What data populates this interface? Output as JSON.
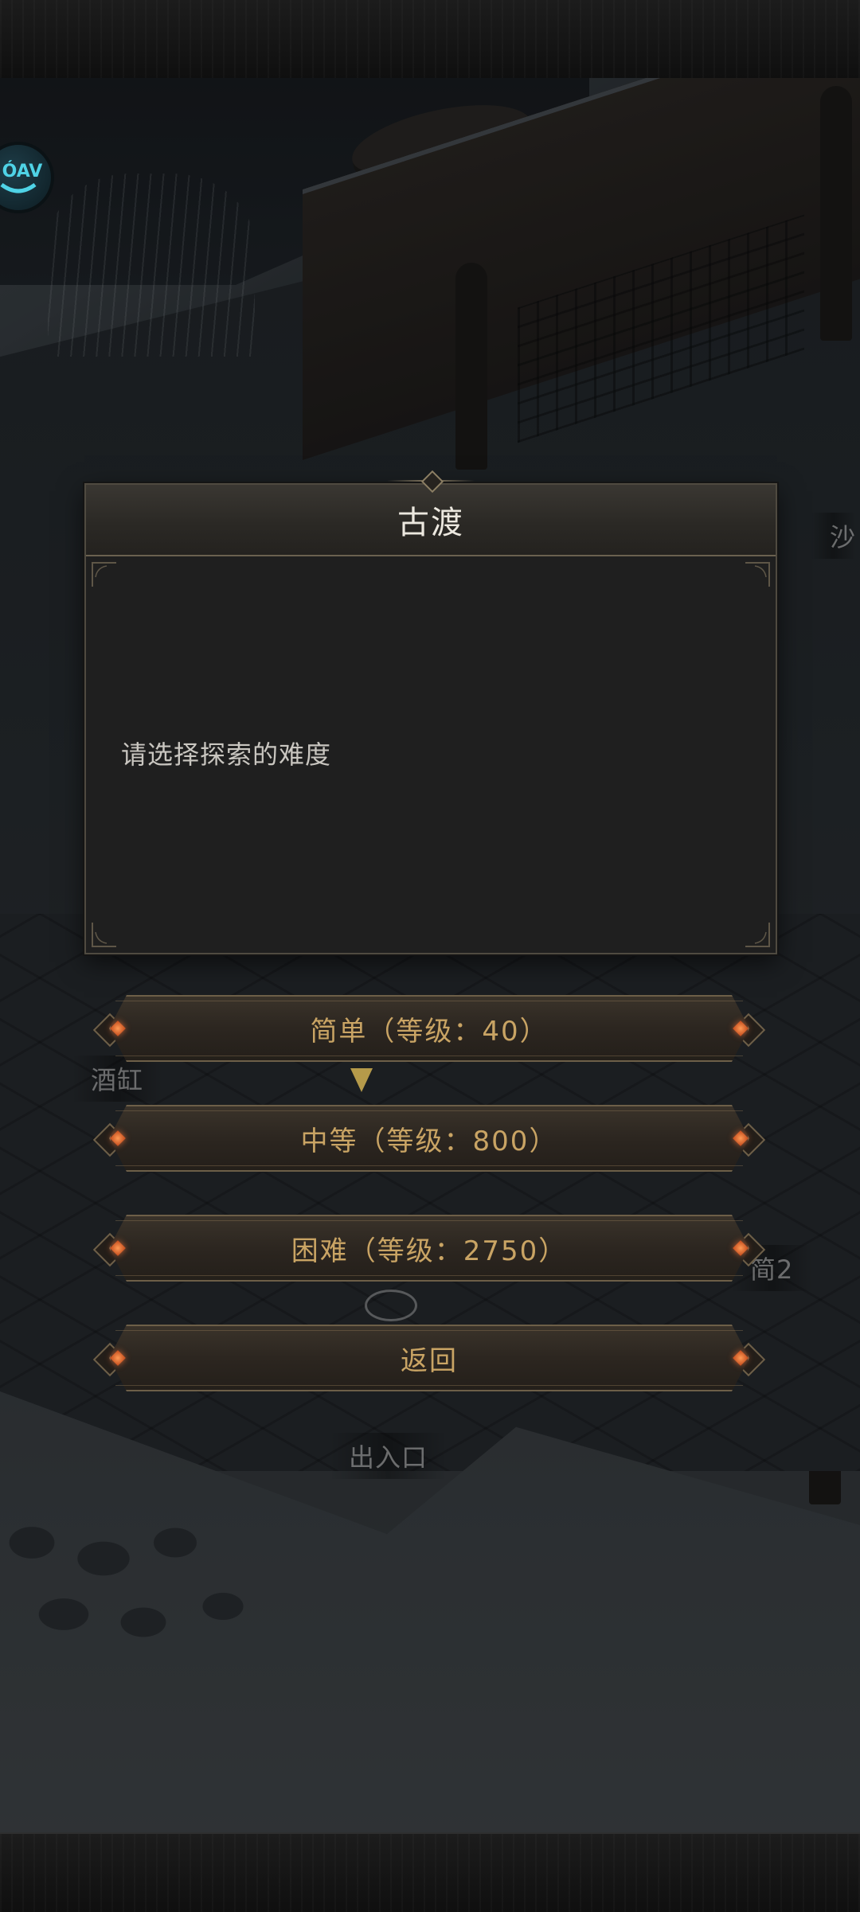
{
  "dialog": {
    "title": "古渡",
    "message": "请选择探索的难度"
  },
  "options": [
    {
      "label": "简单（等级：40）"
    },
    {
      "label": "中等（等级：800）"
    },
    {
      "label": "困难（等级：2750）"
    },
    {
      "label": "返回"
    }
  ],
  "scene_labels": {
    "wine_jar": "酒缸",
    "entrance": "出入口",
    "right_partial_top": "沙",
    "right_partial_mid": "简2"
  },
  "badge": {
    "text": "ÓAV"
  },
  "colors": {
    "button_text": "#c9a464",
    "dialog_bg": "#1f1f1f",
    "title_text": "#ece8df",
    "gem": "#ff7a3c"
  }
}
